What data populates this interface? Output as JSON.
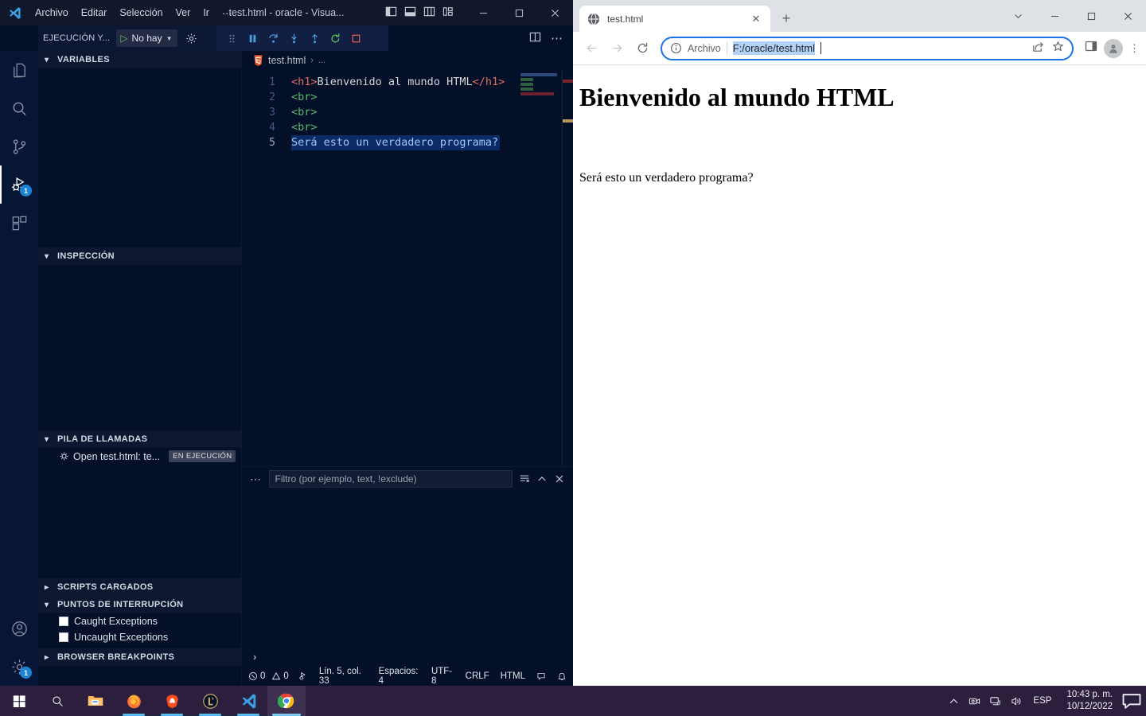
{
  "vscode": {
    "menu": [
      "Archivo",
      "Editar",
      "Selección",
      "Ver",
      "Ir",
      "⋯"
    ],
    "title": "test.html - oracle - Visua...",
    "debug_toolbar": {
      "config_label": "EJECUCIÓN Y...",
      "selected_config": "No hay",
      "play_icon": "play-icon",
      "chevron_icon": "chevron-down-icon",
      "gear_icon": "gear-icon",
      "actions": [
        "drag-handle-icon",
        "pause-icon",
        "step-over-icon",
        "step-into-icon",
        "step-out-icon",
        "restart-icon",
        "stop-icon"
      ]
    },
    "activity_bar": [
      {
        "name": "explorer",
        "icon": "files-icon",
        "badge": ""
      },
      {
        "name": "search",
        "icon": "search-icon",
        "badge": ""
      },
      {
        "name": "source-control",
        "icon": "source-control-icon",
        "badge": ""
      },
      {
        "name": "run-and-debug",
        "icon": "debug-icon",
        "badge": "1"
      },
      {
        "name": "extensions",
        "icon": "extensions-icon",
        "badge": ""
      },
      {
        "name": "accounts",
        "icon": "account-icon",
        "badge": ""
      },
      {
        "name": "manage",
        "icon": "gear-icon",
        "badge": "1"
      }
    ],
    "sidebar": {
      "sections": [
        {
          "label": "VARIABLES",
          "expanded": true
        },
        {
          "label": "INSPECCIÓN",
          "expanded": true
        },
        {
          "label": "PILA DE LLAMADAS",
          "expanded": true
        },
        {
          "label": "SCRIPTS CARGADOS",
          "expanded": false
        },
        {
          "label": "PUNTOS DE INTERRUPCIÓN",
          "expanded": true
        },
        {
          "label": "BROWSER BREAKPOINTS",
          "expanded": false
        }
      ],
      "callstack": {
        "label": "Open test.html: te...",
        "status": "EN EJECUCIÓN"
      },
      "breakpoints": [
        {
          "label": "Caught Exceptions",
          "checked": false
        },
        {
          "label": "Uncaught Exceptions",
          "checked": false
        }
      ]
    },
    "breadcrumb": {
      "file": "test.html",
      "separator": "›",
      "more": "..."
    },
    "code": {
      "lines": [
        "1",
        "2",
        "3",
        "4",
        "5"
      ],
      "l1_open": "<h1>",
      "l1_text": "Bienvenido al mundo HTML",
      "l1_close": "</h1>",
      "l2": "<br>",
      "l3": "<br>",
      "l4": "<br>",
      "l5": "Será esto un verdadero programa?"
    },
    "panel": {
      "filter_placeholder": "Filtro (por ejemplo, text, !exclude)",
      "dots": "⋯",
      "prompt": "›"
    },
    "statusbar": {
      "errors": "0",
      "warnings": "0",
      "position": "Lín. 5, col. 33",
      "indent": "Espacios: 4",
      "encoding": "UTF-8",
      "eol": "CRLF",
      "language": "HTML"
    }
  },
  "browser": {
    "tab": {
      "title": "test.html",
      "favicon": "globe-icon",
      "close": "✕"
    },
    "newtab_label": "+",
    "omnibox": {
      "scheme_label": "Archivo",
      "url": "F:/oracle/test.html",
      "info_icon": "info-circle-icon",
      "share_icon": "share-icon",
      "star_icon": "star-icon"
    },
    "toolbar": {
      "back": "back-arrow-icon",
      "forward": "forward-arrow-icon",
      "reload": "reload-icon",
      "side_panel": "side-panel-icon",
      "profile": "avatar-icon",
      "menu": "⋮"
    },
    "page": {
      "heading": "Bienvenido al mundo HTML",
      "paragraph": "Será esto un verdadero programa?"
    }
  },
  "taskbar": {
    "items": [
      {
        "name": "start",
        "icon": "windows-logo-icon"
      },
      {
        "name": "search",
        "icon": "search-icon"
      },
      {
        "name": "file-explorer",
        "icon": "folder-icon"
      },
      {
        "name": "firefox",
        "icon": "firefox-icon"
      },
      {
        "name": "brave",
        "icon": "brave-icon"
      },
      {
        "name": "league-of-legends",
        "icon": "lol-icon"
      },
      {
        "name": "vscode",
        "icon": "vscode-icon"
      },
      {
        "name": "chrome",
        "icon": "chrome-icon"
      }
    ],
    "tray": {
      "chevron": "chevron-up-icon",
      "icons": [
        "camera-icon",
        "network-icon",
        "volume-icon"
      ],
      "language": "ESP",
      "time": "10:43 p. m.",
      "date": "10/12/2022",
      "action_center": "notification-icon"
    }
  }
}
